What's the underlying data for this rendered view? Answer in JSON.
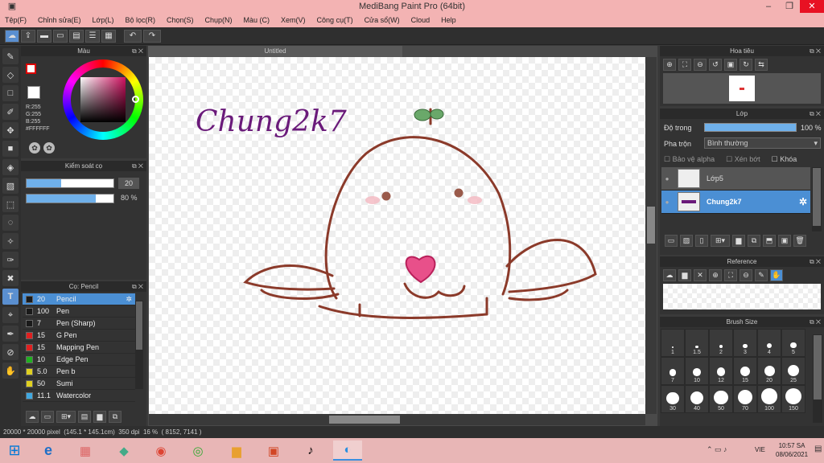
{
  "window": {
    "title": "MediBang Paint Pro (64bit)"
  },
  "menu": [
    "Tệp(F)",
    "Chỉnh sửa(E)",
    "Lớp(L)",
    "Bộ lọc(R)",
    "Chọn(S)",
    "Chụp(N)",
    "Màu (C)",
    "Xem(V)",
    "Công cụ(T)",
    "Cửa sổ(W)",
    "Cloud",
    "Help"
  ],
  "color_panel": {
    "title": "Màu",
    "r": "R:255",
    "g": "G:255",
    "b": "B:255",
    "hex": "#FFFFFF"
  },
  "brush_control": {
    "title": "Kiểm soát cọ",
    "size": "20",
    "opacity": "80",
    "opacity_unit": "%",
    "size_fill": 0.4,
    "opacity_fill": 0.8
  },
  "brush_panel": {
    "title": "Cọ: Pencil",
    "brushes": [
      {
        "size": "20",
        "name": "Pencil",
        "color": "#1a1a1a",
        "selected": true
      },
      {
        "size": "100",
        "name": "Pen",
        "color": "#1a1a1a"
      },
      {
        "size": "7",
        "name": "Pen (Sharp)",
        "color": "#1a1a1a"
      },
      {
        "size": "15",
        "name": "G Pen",
        "color": "#e02020"
      },
      {
        "size": "15",
        "name": "Mapping Pen",
        "color": "#e02020"
      },
      {
        "size": "10",
        "name": "Edge Pen",
        "color": "#20b020"
      },
      {
        "size": "5.0",
        "name": "Pen b",
        "color": "#e0d020"
      },
      {
        "size": "50",
        "name": "Sumi",
        "color": "#e0d020"
      },
      {
        "size": "11.1",
        "name": "Watercolor",
        "color": "#40a8e0"
      }
    ]
  },
  "canvas": {
    "tab": "Untitled",
    "artwork_text": "Chung2k7"
  },
  "navigator": {
    "title": "Hoa tiêu"
  },
  "layer_panel": {
    "title": "Lớp",
    "opacity_label": "Độ trong",
    "opacity_value": "100 %",
    "blend_label": "Pha trộn",
    "blend_value": "Bình thường",
    "protect_alpha": "Bảo vệ alpha",
    "clipping": "Xén bớt",
    "lock": "Khóa",
    "layers": [
      {
        "name": "Lớp5",
        "selected": false
      },
      {
        "name": "Chung2k7",
        "selected": true
      }
    ]
  },
  "reference": {
    "title": "Reference"
  },
  "brush_size": {
    "title": "Brush Size",
    "labels": [
      "1",
      "1.5",
      "2",
      "3",
      "4",
      "5",
      "7",
      "10",
      "12",
      "15",
      "20",
      "25",
      "30",
      "40",
      "50",
      "70",
      "100",
      "150"
    ]
  },
  "status": {
    "dims": "20000 * 20000 pixel",
    "phys": "(145.1 * 145.1cm)",
    "dpi": "350 dpi",
    "zoom": "16 %",
    "coords": "( 8152, 7141 )"
  },
  "taskbar": {
    "lang": "VIE",
    "time": "10:57 SA",
    "date": "08/06/2021"
  },
  "colors": {
    "accent": "#4b8fd4",
    "titlebar": "#f3b3b3",
    "outline": "#8b3a2a",
    "text_purple": "#6a1a7a",
    "heart": "#e8508a"
  }
}
